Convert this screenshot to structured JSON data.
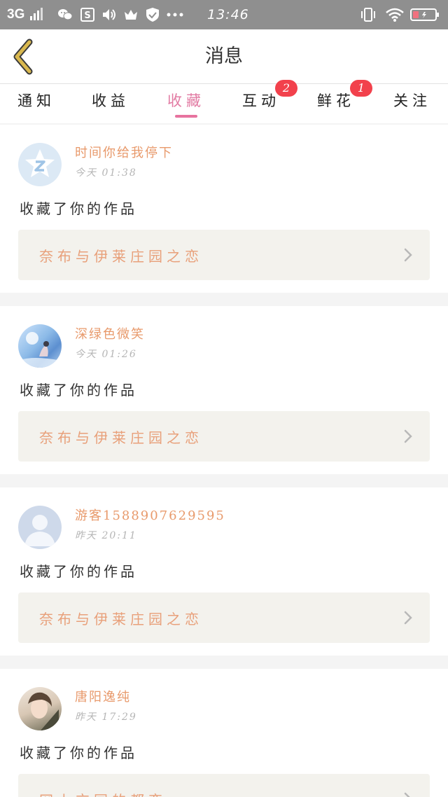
{
  "status_bar": {
    "network": "3G",
    "time": "13:46",
    "icons": [
      "signal-icon",
      "wechat-icon",
      "s-app-icon",
      "volume-icon",
      "crown-icon",
      "shield-icon",
      "more-dots-icon",
      "vibrate-icon",
      "wifi-icon",
      "battery-icon"
    ]
  },
  "header": {
    "title": "消息",
    "back_icon": "back-chevron-icon",
    "accent_color": "#d9b84f"
  },
  "tabs": [
    {
      "label": "通知",
      "active": false,
      "badge": null
    },
    {
      "label": "收益",
      "active": false,
      "badge": null
    },
    {
      "label": "收藏",
      "active": true,
      "badge": null
    },
    {
      "label": "互动",
      "active": false,
      "badge": "2"
    },
    {
      "label": "鲜花",
      "active": false,
      "badge": "1"
    },
    {
      "label": "关注",
      "active": false,
      "badge": null
    }
  ],
  "messages": [
    {
      "username": "时间你给我停下",
      "time": "今天  01:38",
      "action": "收藏了你的作品",
      "work_title": "奈布与伊莱庄园之恋",
      "avatar": "qq-logo-avatar"
    },
    {
      "username": "深绿色微笑",
      "time": "今天  01:26",
      "action": "收藏了你的作品",
      "work_title": "奈布与伊莱庄园之恋",
      "avatar": "photo-avatar"
    },
    {
      "username": "游客1588907629595",
      "time": "昨天  20:11",
      "action": "收藏了你的作品",
      "work_title": "奈布与伊莱庄园之恋",
      "avatar": "default-user-avatar"
    },
    {
      "username": "唐阳逸纯",
      "time": "昨天  17:29",
      "action": "收藏了你的作品",
      "work_title": "网上交同的都恋",
      "avatar": "photo-avatar"
    }
  ],
  "colors": {
    "active_tab": "#e27ba3",
    "username": "#e89a6c",
    "work_title": "#e8a07a",
    "badge": "#f2414c"
  }
}
